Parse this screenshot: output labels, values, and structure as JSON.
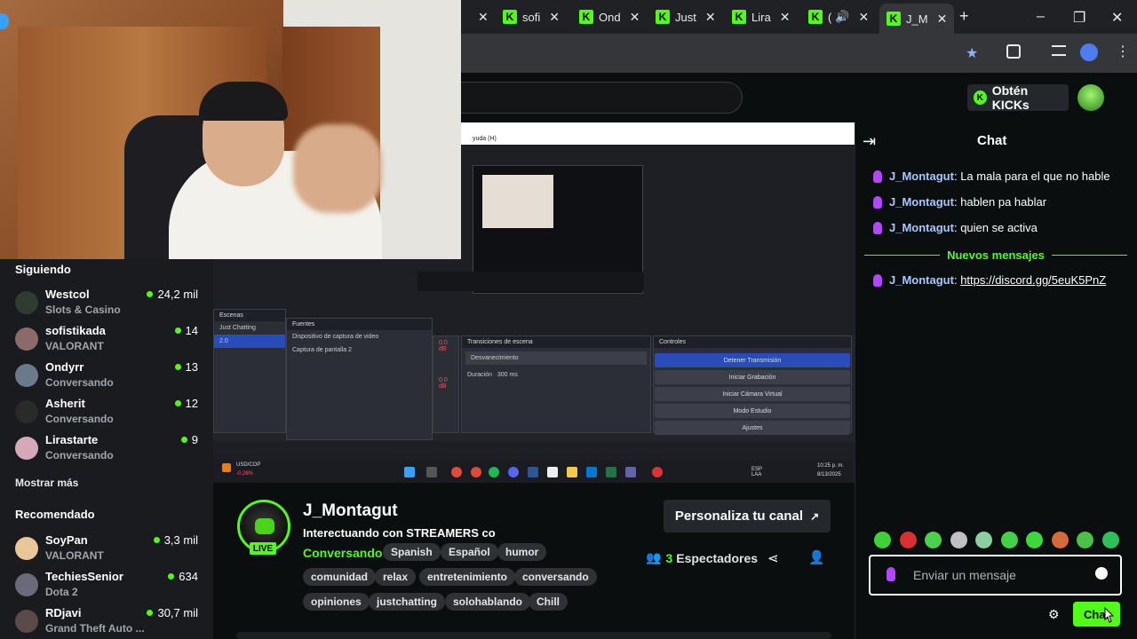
{
  "browser": {
    "tabs": [
      {
        "label": "sofi"
      },
      {
        "label": "Ond"
      },
      {
        "label": "Just"
      },
      {
        "label": "Lira"
      },
      {
        "label": "("
      },
      {
        "label": "J_M"
      }
    ],
    "new_tab": "+",
    "close": "✕",
    "minimize": "–",
    "restore": "❐"
  },
  "topbar": {
    "kicks_label": "Obtén KICKs",
    "kicks_coin": "K"
  },
  "sidebar": {
    "following_title": "Siguiendo",
    "following": [
      {
        "name": "Westcol",
        "category": "Slots & Casino",
        "viewers": "24,2 mil",
        "color": "#3a4a3a"
      },
      {
        "name": "sofistikada",
        "category": "VALORANT",
        "viewers": "14",
        "color": "#8b6a6a"
      },
      {
        "name": "Ondyrr",
        "category": "Conversando",
        "viewers": "13",
        "color": "#6a7a8a"
      },
      {
        "name": "Asherit",
        "category": "Conversando",
        "viewers": "12",
        "color": "#2a2a2a"
      },
      {
        "name": "Lirastarte",
        "category": "Conversando",
        "viewers": "9",
        "color": "#d6a8b8"
      }
    ],
    "show_more": "Mostrar más",
    "recommended_title": "Recomendado",
    "recommended": [
      {
        "name": "SoyPan",
        "category": "VALORANT",
        "viewers": "3,3 mil",
        "color": "#e8c89a"
      },
      {
        "name": "TechiesSenior",
        "category": "Dota 2",
        "viewers": "634",
        "color": "#6a6a7a"
      },
      {
        "name": "RDjavi",
        "category": "Grand Theft Auto ...",
        "viewers": "30,7 mil",
        "color": "#5a4a4a"
      }
    ]
  },
  "stream": {
    "obs_menu": "yuda (H)",
    "scenes_title": "Escenas",
    "scene_items": [
      "Just Chatting",
      "2.0"
    ],
    "sources_title": "Fuentes",
    "sources": [
      "Dispositivo de captura de video",
      "Captura de pantalla 2"
    ],
    "transitions_title": "Transiciones de escena",
    "transition_value": "Desvanecimiento",
    "duration_label": "Duración",
    "duration_value": "300 ms",
    "controls_title": "Controles",
    "controls": [
      "Detener Transmisión",
      "Iniciar Grabación",
      "Iniciar Cámara Virtual",
      "Modo Estudio",
      "Ajustes"
    ],
    "audio_db": [
      "0.0 dB",
      "0.0 dB"
    ],
    "ticker_name": "USD/COP",
    "ticker_change": "-0,26%",
    "tray_lang": "ESP\nLAA",
    "clock_time": "10:25 p. m.",
    "clock_date": "8/13/2025"
  },
  "streamer": {
    "name": "J_Montagut",
    "title": "Interectuando con STREAMERS co",
    "category": "Conversando",
    "live_label": "LIVE",
    "tags_row1": [
      "Spanish",
      "Español",
      "humor"
    ],
    "tags_row2": [
      "comunidad",
      "relax",
      "entretenimiento",
      "conversando"
    ],
    "tags_row3": [
      "opiniones",
      "justchatting",
      "solohablando",
      "Chill"
    ],
    "customize_label": "Personaliza tu canal",
    "viewers_count": "3",
    "viewers_label": "Espectadores"
  },
  "chat": {
    "title": "Chat",
    "messages": [
      {
        "user": "J_Montagut",
        "text": "La mala para el que no hable"
      },
      {
        "user": "J_Montagut",
        "text": "hablen pa hablar"
      },
      {
        "user": "J_Montagut",
        "text": "quien se activa"
      }
    ],
    "new_messages": "Nuevos mensajes",
    "after_messages": [
      {
        "user": "J_Montagut",
        "text": "https://discord.gg/5euK5PnZ"
      }
    ],
    "input_placeholder": "Enviar un mensaje",
    "send_label": "Chat",
    "emote_colors": [
      "#3fd13a",
      "#d83030",
      "#4ad14a",
      "#c0c0c0",
      "#8ad0a0",
      "#46d046",
      "#3ed83e",
      "#d66a3a",
      "#4ac24a",
      "#2fbf5a"
    ]
  },
  "colors": {
    "accent": "#53fc18",
    "badge": "#b546ff",
    "username": "#a7c7ff"
  }
}
